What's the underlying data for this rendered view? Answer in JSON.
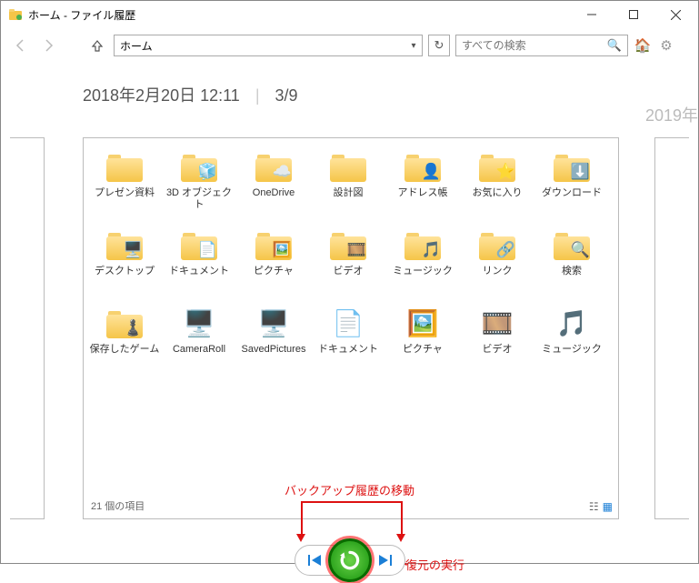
{
  "window": {
    "title": "ホーム - ファイル履歴"
  },
  "toolbar": {
    "path": "ホーム",
    "search_placeholder": "すべての検索"
  },
  "header": {
    "timestamp": "2018年2月20日 12:11",
    "position": "3/9",
    "next_timestamp": "2019年"
  },
  "status": {
    "count": "21 個の項目"
  },
  "annotations": {
    "move_history": "バックアップ履歴の移動",
    "restore": "復元の実行"
  },
  "items": [
    {
      "label": "プレゼン資料",
      "type": "folder",
      "overlay": ""
    },
    {
      "label": "3D オブジェクト",
      "type": "folder",
      "overlay": "🧊"
    },
    {
      "label": "OneDrive",
      "type": "folder",
      "overlay": "☁️"
    },
    {
      "label": "設計図",
      "type": "folder",
      "overlay": ""
    },
    {
      "label": "アドレス帳",
      "type": "folder",
      "overlay": "👤"
    },
    {
      "label": "お気に入り",
      "type": "folder",
      "overlay": "⭐"
    },
    {
      "label": "ダウンロード",
      "type": "folder",
      "overlay": "⬇️"
    },
    {
      "label": "デスクトップ",
      "type": "folder",
      "overlay": "🖥️"
    },
    {
      "label": "ドキュメント",
      "type": "folder",
      "overlay": "📄"
    },
    {
      "label": "ピクチャ",
      "type": "folder",
      "overlay": "🖼️"
    },
    {
      "label": "ビデオ",
      "type": "folder",
      "overlay": "🎞️"
    },
    {
      "label": "ミュージック",
      "type": "folder",
      "overlay": "🎵"
    },
    {
      "label": "リンク",
      "type": "folder",
      "overlay": "🔗"
    },
    {
      "label": "検索",
      "type": "folder",
      "overlay": "🔍"
    },
    {
      "label": "保存したゲーム",
      "type": "folder",
      "overlay": "♟️"
    },
    {
      "label": "CameraRoll",
      "type": "lib",
      "overlay": "🖥️"
    },
    {
      "label": "SavedPictures",
      "type": "lib",
      "overlay": "🖥️"
    },
    {
      "label": "ドキュメント",
      "type": "lib",
      "overlay": "📄"
    },
    {
      "label": "ピクチャ",
      "type": "lib",
      "overlay": "🖼️"
    },
    {
      "label": "ビデオ",
      "type": "lib",
      "overlay": "🎞️"
    },
    {
      "label": "ミュージック",
      "type": "lib",
      "overlay": "🎵"
    }
  ]
}
